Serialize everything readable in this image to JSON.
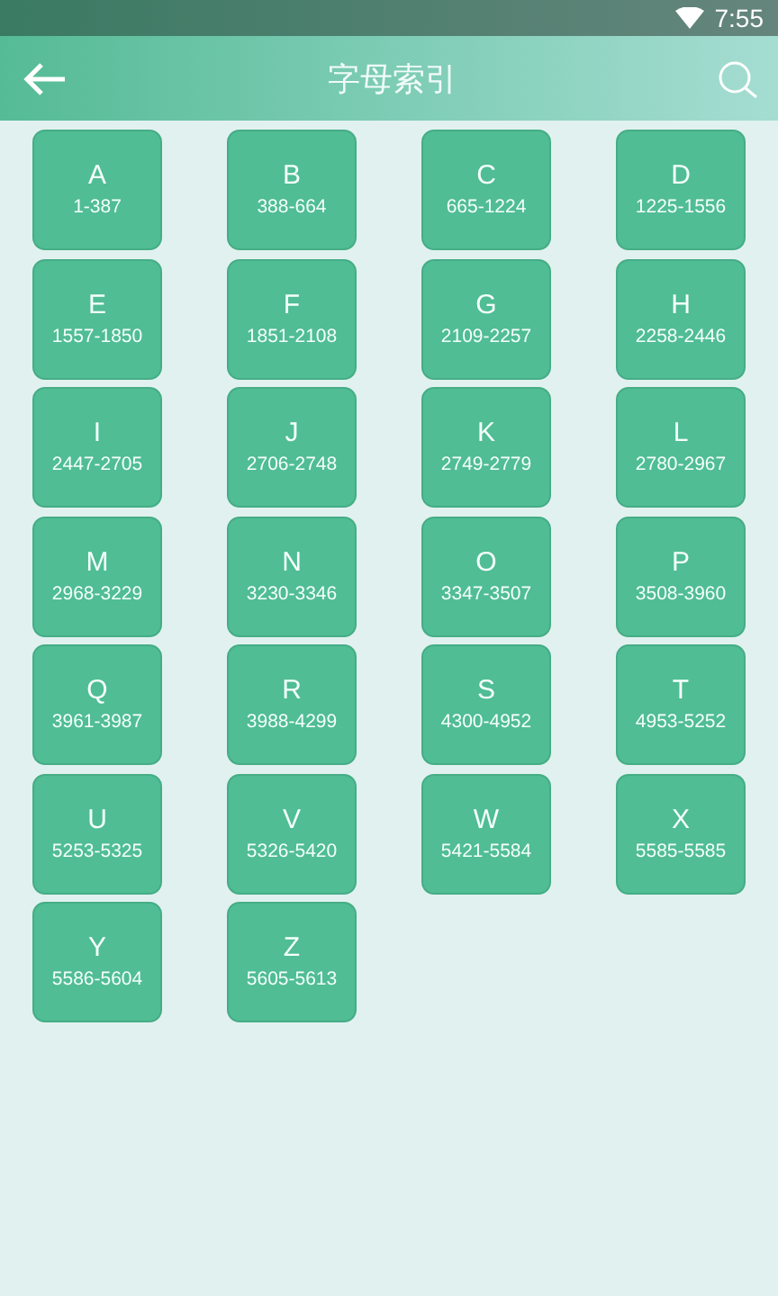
{
  "status_bar": {
    "time": "7:55"
  },
  "app_bar": {
    "title": "字母索引"
  },
  "letters": [
    {
      "letter": "A",
      "range": "1-387"
    },
    {
      "letter": "B",
      "range": "388-664"
    },
    {
      "letter": "C",
      "range": "665-1224"
    },
    {
      "letter": "D",
      "range": "1225-1556"
    },
    {
      "letter": "E",
      "range": "1557-1850"
    },
    {
      "letter": "F",
      "range": "1851-2108"
    },
    {
      "letter": "G",
      "range": "2109-2257"
    },
    {
      "letter": "H",
      "range": "2258-2446"
    },
    {
      "letter": "I",
      "range": "2447-2705"
    },
    {
      "letter": "J",
      "range": "2706-2748"
    },
    {
      "letter": "K",
      "range": "2749-2779"
    },
    {
      "letter": "L",
      "range": "2780-2967"
    },
    {
      "letter": "M",
      "range": "2968-3229"
    },
    {
      "letter": "N",
      "range": "3230-3346"
    },
    {
      "letter": "O",
      "range": "3347-3507"
    },
    {
      "letter": "P",
      "range": "3508-3960"
    },
    {
      "letter": "Q",
      "range": "3961-3987"
    },
    {
      "letter": "R",
      "range": "3988-4299"
    },
    {
      "letter": "S",
      "range": "4300-4952"
    },
    {
      "letter": "T",
      "range": "4953-5252"
    },
    {
      "letter": "U",
      "range": "5253-5325"
    },
    {
      "letter": "V",
      "range": "5326-5420"
    },
    {
      "letter": "W",
      "range": "5421-5584"
    },
    {
      "letter": "X",
      "range": "5585-5585"
    },
    {
      "letter": "Y",
      "range": "5586-5604"
    },
    {
      "letter": "Z",
      "range": "5605-5613"
    }
  ]
}
